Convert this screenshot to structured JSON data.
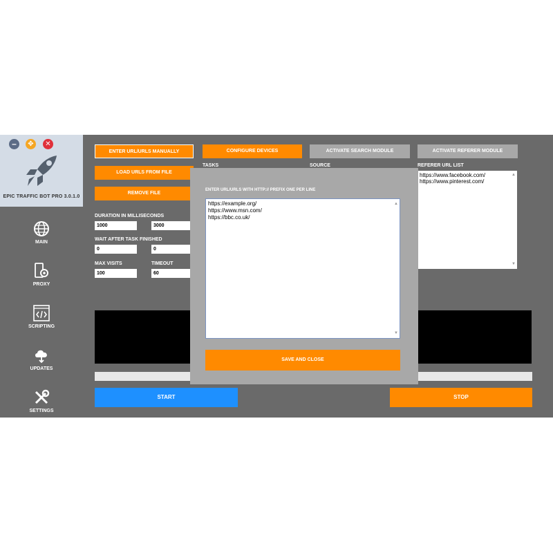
{
  "app": {
    "title": "EPIC TRAFFIC BOT PRO  3.0.1.0",
    "colors": {
      "accent": "#ff8a00",
      "start": "#1e90ff",
      "background": "#6a6a6a"
    }
  },
  "window_controls": {
    "minimize": "–",
    "move": "✥",
    "close": "✕"
  },
  "sidebar": {
    "items": [
      {
        "label": "MAIN",
        "icon": "globe-icon"
      },
      {
        "label": "PROXY",
        "icon": "proxy-gear-icon"
      },
      {
        "label": "SCRIPTING",
        "icon": "code-icon"
      },
      {
        "label": "UPDATES",
        "icon": "cloud-download-icon"
      },
      {
        "label": "SETTINGS",
        "icon": "tools-icon"
      }
    ]
  },
  "toolbar": {
    "enter_urls": "ENTER URL/URLS MANUALLY",
    "configure_devices": "CONFIGURE DEVICES",
    "activate_search": "ACTIVATE SEARCH MODULE",
    "activate_referer": "ACTIVATE REFERER MODULE",
    "load_urls": "LOAD URLS FROM FILE",
    "remove_file": "REMOVE FILE"
  },
  "labels": {
    "tasks": "TASKS",
    "source": "SOURCE",
    "referer_list": "REFERER URL LIST",
    "duration": "DURATION IN MILLISECONDS",
    "wait_after": "WAIT AFTER TASK FINISHED",
    "max_visits": "MAX VISITS",
    "timeout": "TIMEOUT"
  },
  "fields": {
    "duration_min": "1000",
    "duration_max": "3000",
    "wait_min": "0",
    "wait_max": "0",
    "max_visits": "100",
    "timeout": "60"
  },
  "referer_urls": [
    "https://www.facebook.com/",
    "https://www.pinterest.com/"
  ],
  "buttons": {
    "start": "START",
    "stop": "STOP"
  },
  "modal": {
    "caption": "ENTER URL/URLS WITH HTTP:// PREFIX ONE PER LINE",
    "urls": [
      "https://example.org/",
      "https://www.msn.com/",
      "https://bbc.co.uk/"
    ],
    "save": "SAVE AND CLOSE"
  },
  "scroll": {
    "up": "▲",
    "down": "▼"
  }
}
